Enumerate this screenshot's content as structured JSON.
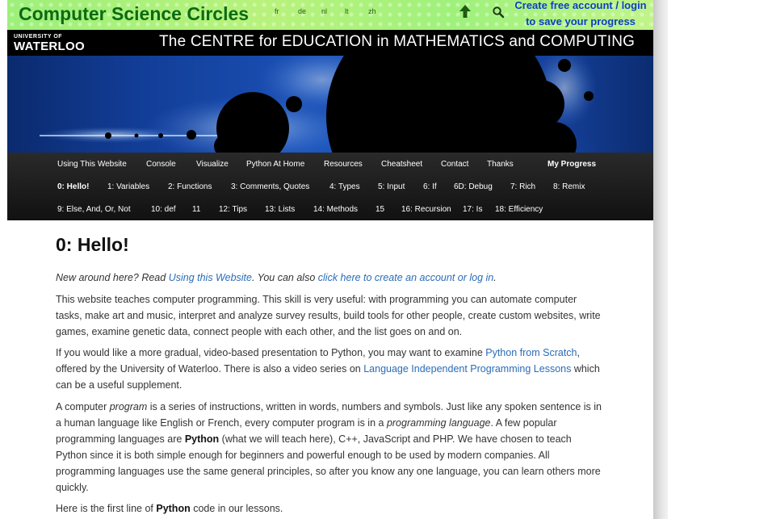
{
  "header": {
    "site_title": "Computer Science Circles",
    "languages": [
      "fr",
      "de",
      "nl",
      "lt",
      "zh"
    ],
    "account_line1": "Create free account / login",
    "account_line2": "to save your progress",
    "up_icon": "up-arrow-icon",
    "search_icon": "search-icon",
    "colors": {
      "bar_green": "#9df07a",
      "title": "#0b6b12",
      "account": "#0a3fc4"
    }
  },
  "banner": {
    "uw_small": "UNIVERSITY OF",
    "uw_big": "WATERLOO",
    "cemc_title": "The CENTRE for EDUCATION in MATHEMATICS and COMPUTING"
  },
  "nav": {
    "row1": [
      "Using This Website",
      "Console",
      "Visualize",
      "Python At Home",
      "Resources",
      "Cheatsheet",
      "Contact",
      "Thanks",
      "My Progress"
    ],
    "row2": [
      "0: Hello!",
      "1: Variables",
      "2: Functions",
      "3: Comments, Quotes",
      "4: Types",
      "5: Input",
      "6: If",
      "6D: Debug",
      "7: Rich",
      "8: Remix"
    ],
    "row3": [
      "9: Else, And, Or, Not",
      "10: def",
      "11",
      "12: Tips",
      "13: Lists",
      "14: Methods",
      "15",
      "16: Recursion",
      "17: Is",
      "18: Efficiency"
    ]
  },
  "main": {
    "title": "0: Hello!",
    "intro": {
      "prefix": "New around here? Read ",
      "link1": "Using this Website",
      "middle": ". You can also ",
      "link2": "click here to create an account or log in",
      "suffix": "."
    },
    "p1": "This website teaches computer programming. This skill is very useful: with programming you can automate computer tasks, make art and music, interpret and analyze survey results, build tools for other people, create custom websites, write games, examine genetic data, connect people with each other, and the list goes on and on.",
    "p2": {
      "a": "If you would like a more gradual, video-based presentation to Python, you may want to examine ",
      "link1": "Python from Scratch",
      "b": ", offered by the University of Waterloo. There is also a video series on ",
      "link2": "Language Independent Programming Lessons",
      "c": " which can be a useful supplement."
    },
    "p3": {
      "a": "A computer ",
      "em1": "program",
      "b": " is a series of instructions, written in words, numbers and symbols. Just like any spoken sentence is in a human language like English or French, every computer program is in a ",
      "em2": "programming language",
      "c": ". A few popular programming languages are ",
      "strong1": "Python",
      "d": " (what we will teach here), C++, JavaScript and PHP. We have chosen to teach Python since it is both simple enough for beginners and powerful enough to be used by modern companies. All programming languages use the same general principles, so after you know any one language, you can learn others more quickly."
    },
    "p4": {
      "a": "Here is the first line of ",
      "strong1": "Python",
      "b": " code in our lessons."
    }
  }
}
